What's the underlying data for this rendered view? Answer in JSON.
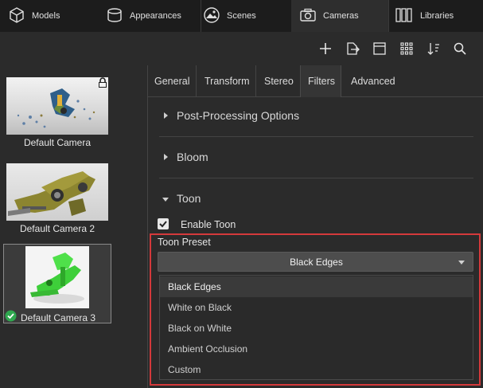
{
  "top_tabs": [
    {
      "label": "Models",
      "icon": "cube-icon"
    },
    {
      "label": "Appearances",
      "icon": "sphere-icon"
    },
    {
      "label": "Scenes",
      "icon": "landscape-icon"
    },
    {
      "label": "Cameras",
      "icon": "camera-icon",
      "active": true
    },
    {
      "label": "Libraries",
      "icon": "books-icon"
    }
  ],
  "toolbar": {
    "icons": [
      "add-icon",
      "export-icon",
      "layout-icon",
      "grid-icon",
      "sort-icon",
      "search-icon"
    ]
  },
  "cameras": [
    {
      "label": "Default Camera",
      "locked": true
    },
    {
      "label": "Default Camera 2"
    },
    {
      "label": "Default Camera 3",
      "selected": true,
      "active_check": true
    }
  ],
  "sub_tabs": [
    {
      "label": "General"
    },
    {
      "label": "Transform"
    },
    {
      "label": "Stereo"
    },
    {
      "label": "Filters",
      "active": true
    },
    {
      "label": "Advanced"
    }
  ],
  "sections": {
    "post_processing": "Post-Processing Options",
    "bloom": "Bloom",
    "toon": "Toon"
  },
  "toon": {
    "enable_label": "Enable Toon",
    "enabled": true,
    "preset_label": "Toon Preset",
    "preset_value": "Black Edges",
    "options": [
      "Black Edges",
      "White on Black",
      "Black on White",
      "Ambient Occlusion",
      "Custom"
    ]
  },
  "colors": {
    "highlight": "#d4393b",
    "check_green": "#2fa84f"
  }
}
